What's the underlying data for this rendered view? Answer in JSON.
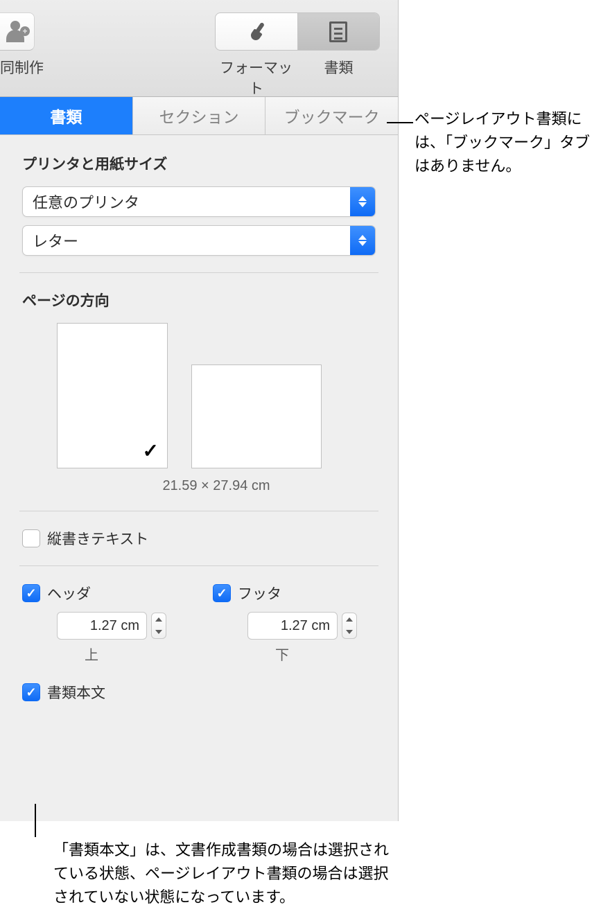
{
  "toolbar": {
    "collab_label": "同制作",
    "seg": {
      "format": "フォーマット",
      "document": "書類"
    }
  },
  "tabs": {
    "document": "書類",
    "section": "セクション",
    "bookmark": "ブックマーク"
  },
  "printer_section": {
    "title": "プリンタと用紙サイズ",
    "printer": "任意のプリンタ",
    "paper": "レター"
  },
  "orientation_section": {
    "title": "ページの方向",
    "dimensions": "21.59 × 27.94 cm"
  },
  "vertical_text": {
    "label": "縦書きテキスト"
  },
  "header": {
    "label": "ヘッダ",
    "value": "1.27 cm",
    "sub": "上"
  },
  "footer": {
    "label": "フッタ",
    "value": "1.27 cm",
    "sub": "下"
  },
  "body_check": {
    "label": "書類本文"
  },
  "callouts": {
    "bookmark_note": "ページレイアウト書類には、「ブックマーク」タブはありません。",
    "body_note": "「書類本文」は、文書作成書類の場合は選択されている状態、ページレイアウト書類の場合は選択されていない状態になっています。"
  }
}
